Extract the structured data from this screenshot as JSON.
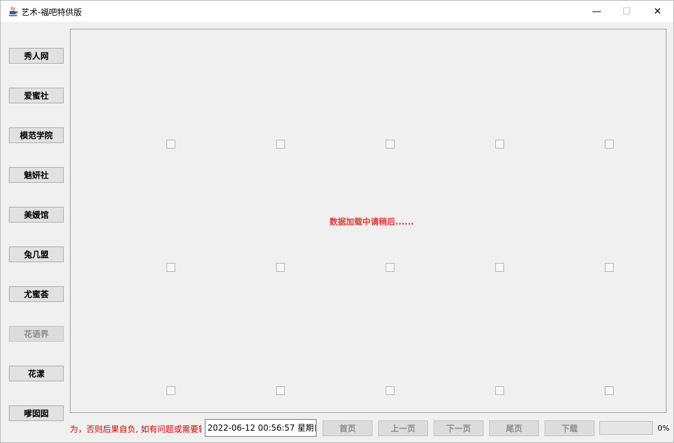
{
  "window": {
    "title": "艺术-福吧特供版",
    "minimize_glyph": "—",
    "maximize_glyph": "☐",
    "close_glyph": "✕"
  },
  "sidebar": {
    "items": [
      {
        "label": "秀人网",
        "enabled": true
      },
      {
        "label": "爱蜜社",
        "enabled": true
      },
      {
        "label": "模范学院",
        "enabled": true
      },
      {
        "label": "魅妍社",
        "enabled": true
      },
      {
        "label": "美媛馆",
        "enabled": true
      },
      {
        "label": "兔几盟",
        "enabled": true
      },
      {
        "label": "尤蜜荟",
        "enabled": true
      },
      {
        "label": "花语界",
        "enabled": false
      },
      {
        "label": "花漾",
        "enabled": true
      },
      {
        "label": "嗲囡囡",
        "enabled": true
      }
    ]
  },
  "main": {
    "loading_text": "数据加载中请稍后......",
    "thumbnail_grid": {
      "rows": 3,
      "cols": 5
    }
  },
  "footer": {
    "notice": "为，否则后果自负, 如有问题或需要转",
    "datetime": "2022-06-12 00:56:57 星期日",
    "buttons": {
      "first": "首页",
      "prev": "上一页",
      "next": "下一页",
      "last": "尾页",
      "download": "下载"
    },
    "progress_percent": 0,
    "progress_text": "0%"
  },
  "colors": {
    "loading": "#e03a3a",
    "notice": "#d40000"
  }
}
